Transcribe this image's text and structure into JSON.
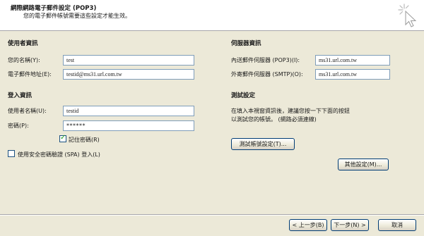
{
  "header": {
    "title": "網際網路電子郵件設定 (POP3)",
    "subtitle": "您的電子郵件帳號需要這些設定才能生效。"
  },
  "user_info": {
    "section_title": "使用者資訊",
    "name_label": "您的名稱(Y):",
    "name_value": "test",
    "email_label": "電子郵件地址(E):",
    "email_value": "testid@ms31.url.com.tw"
  },
  "server_info": {
    "section_title": "伺服器資訊",
    "incoming_label": "內送郵件伺服器 (POP3)(I):",
    "incoming_value": "ms31.url.com.tw",
    "outgoing_label": "外寄郵件伺服器 (SMTP)(O):",
    "outgoing_value": "ms31.url.com.tw"
  },
  "login_info": {
    "section_title": "登入資訊",
    "username_label": "使用者名稱(U):",
    "username_value": "testid",
    "password_label": "密碼(P):",
    "password_value": "******",
    "remember_label": "記住密碼(R)",
    "remember_checked": true,
    "spa_label": "使用安全密碼驗證 (SPA) 登入(L)",
    "spa_checked": false
  },
  "test_settings": {
    "section_title": "測試設定",
    "description_line1": "在填入本視窗資訊後，建議您按一下下面的按鈕",
    "description_line2": "以測試您的帳號。 (網路必須連線)",
    "test_button": "測試帳號設定(T)...",
    "more_settings_button": "其他設定(M)..."
  },
  "footer": {
    "back_button": "< 上一步(B)",
    "next_button": "下一步(N) >",
    "cancel_button": "取消"
  },
  "colors": {
    "background": "#ece9d8",
    "header_background": "#ffffff",
    "input_border": "#7f9db9",
    "button_border": "#003c74",
    "checkmark": "#21a121"
  }
}
